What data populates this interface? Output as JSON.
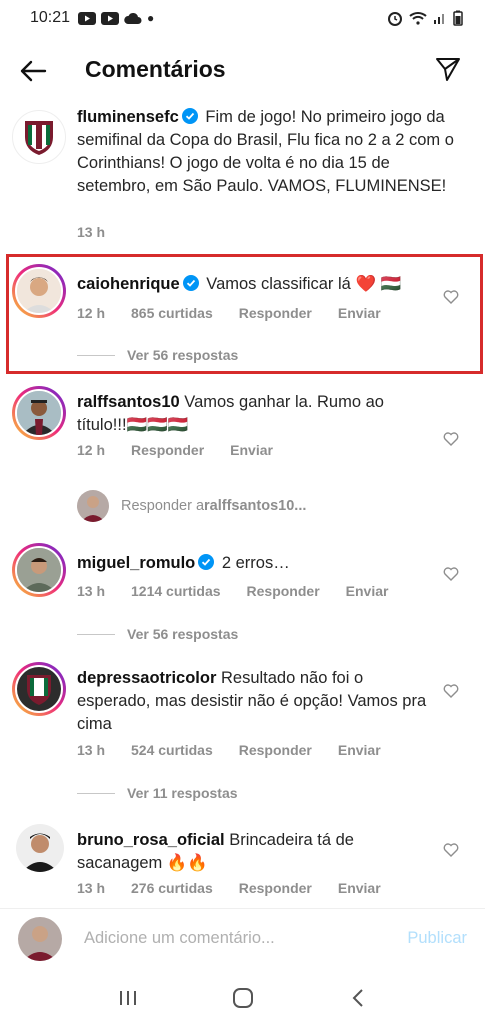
{
  "status_bar": {
    "time": "10:21"
  },
  "header": {
    "title": "Comentários"
  },
  "caption": {
    "username": "fluminensefc",
    "text": " Fim de jogo! No primeiro jogo da semifinal da Copa do Brasil, Flu fica no 2 a 2 com o Corinthians! O jogo de volta é no dia 15 de setembro, em São Paulo. VAMOS, FLUMINENSE!",
    "time": "13 h"
  },
  "comments": [
    {
      "username": "caiohenrique",
      "text": " Vamos classificar lá ❤️ 🇭🇺",
      "time": "12 h",
      "likes": "865 curtidas",
      "reply": "Responder",
      "send": "Enviar",
      "view_replies": "Ver 56 respostas"
    },
    {
      "username": "ralffsantos10",
      "text": " Vamos ganhar la. Rumo ao título!!!🇭🇺🇭🇺🇭🇺",
      "time": "12 h",
      "reply": "Responder",
      "send": "Enviar"
    },
    {
      "username": "miguel_romulo",
      "text": " 2 erros…",
      "time": "13 h",
      "likes": "1214 curtidas",
      "reply": "Responder",
      "send": "Enviar",
      "view_replies": "Ver 56 respostas"
    },
    {
      "username": "depressaotricolor",
      "text": " Resultado não foi o esperado, mas desistir não é opção! Vamos pra cima",
      "time": "13 h",
      "likes": "524 curtidas",
      "reply": "Responder",
      "send": "Enviar",
      "view_replies": "Ver 11 respostas"
    },
    {
      "username": "bruno_rosa_oficial",
      "text": " Brincadeira tá de sacanagem 🔥🔥",
      "time": "13 h",
      "likes": "276 curtidas",
      "reply": "Responder",
      "send": "Enviar"
    }
  ],
  "reply_prompt": {
    "prefix": "Responder a ",
    "target": "ralffsantos10..."
  },
  "composer": {
    "placeholder": "Adicione um comentário...",
    "post": "Publicar"
  },
  "colors": {
    "accent": "#0095f6",
    "highlight": "#d62b2b",
    "muted": "#8e8e8e"
  }
}
